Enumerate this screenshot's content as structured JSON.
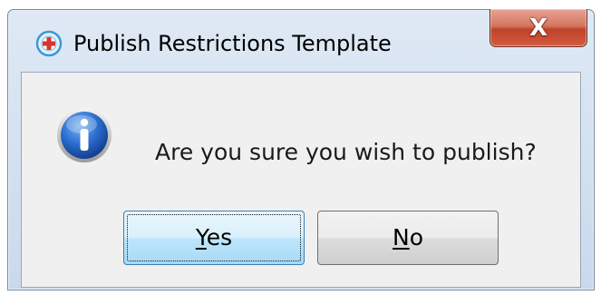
{
  "window": {
    "title": "Publish Restrictions Template",
    "close_glyph": "X"
  },
  "dialog": {
    "message": "Are you sure you wish to publish?",
    "icon": "info-icon"
  },
  "buttons": {
    "yes": {
      "mnemonic": "Y",
      "rest": "es",
      "focused": true
    },
    "no": {
      "mnemonic": "N",
      "rest": "o",
      "focused": false
    }
  },
  "colors": {
    "close_button": "#c9503a",
    "yes_button_border": "#3c7fb1",
    "info_icon_blue": "#1f5fbf"
  }
}
